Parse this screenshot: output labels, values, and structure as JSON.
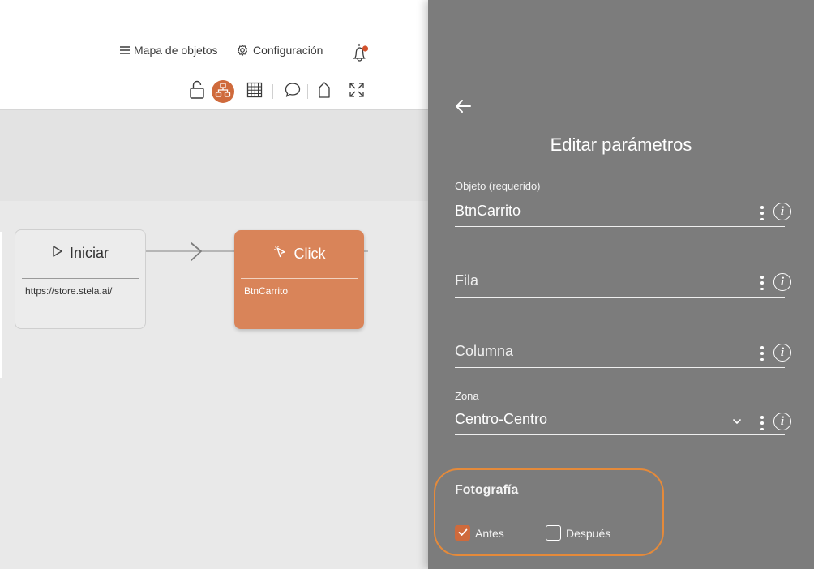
{
  "header": {
    "objects_map_label": "Mapa de objetos",
    "settings_label": "Configuración",
    "icons": [
      "menu-icon",
      "gear-icon",
      "bell-icon",
      "unlock-icon",
      "flow-icon",
      "grid-icon",
      "comment-icon",
      "tag-icon",
      "expand-icon"
    ]
  },
  "canvas": {
    "start_node": {
      "title": "Iniciar",
      "url": "https://store.stela.ai/"
    },
    "click_node": {
      "title": "Click",
      "object": "BtnCarrito"
    }
  },
  "panel": {
    "title": "Editar parámetros",
    "fields": {
      "object": {
        "label": "Objeto (requerido)",
        "value": "BtnCarrito"
      },
      "row": {
        "placeholder": "Fila"
      },
      "column": {
        "placeholder": "Columna"
      },
      "zone": {
        "label": "Zona",
        "value": "Centro-Centro"
      }
    },
    "photo": {
      "title": "Fotografía",
      "before_label": "Antes",
      "before_checked": true,
      "after_label": "Después",
      "after_checked": false
    }
  },
  "colors": {
    "accent": "#cf6a3c",
    "click_node": "#d98459",
    "panel_bg": "#7c7c7c",
    "highlight": "#e58a3a"
  }
}
